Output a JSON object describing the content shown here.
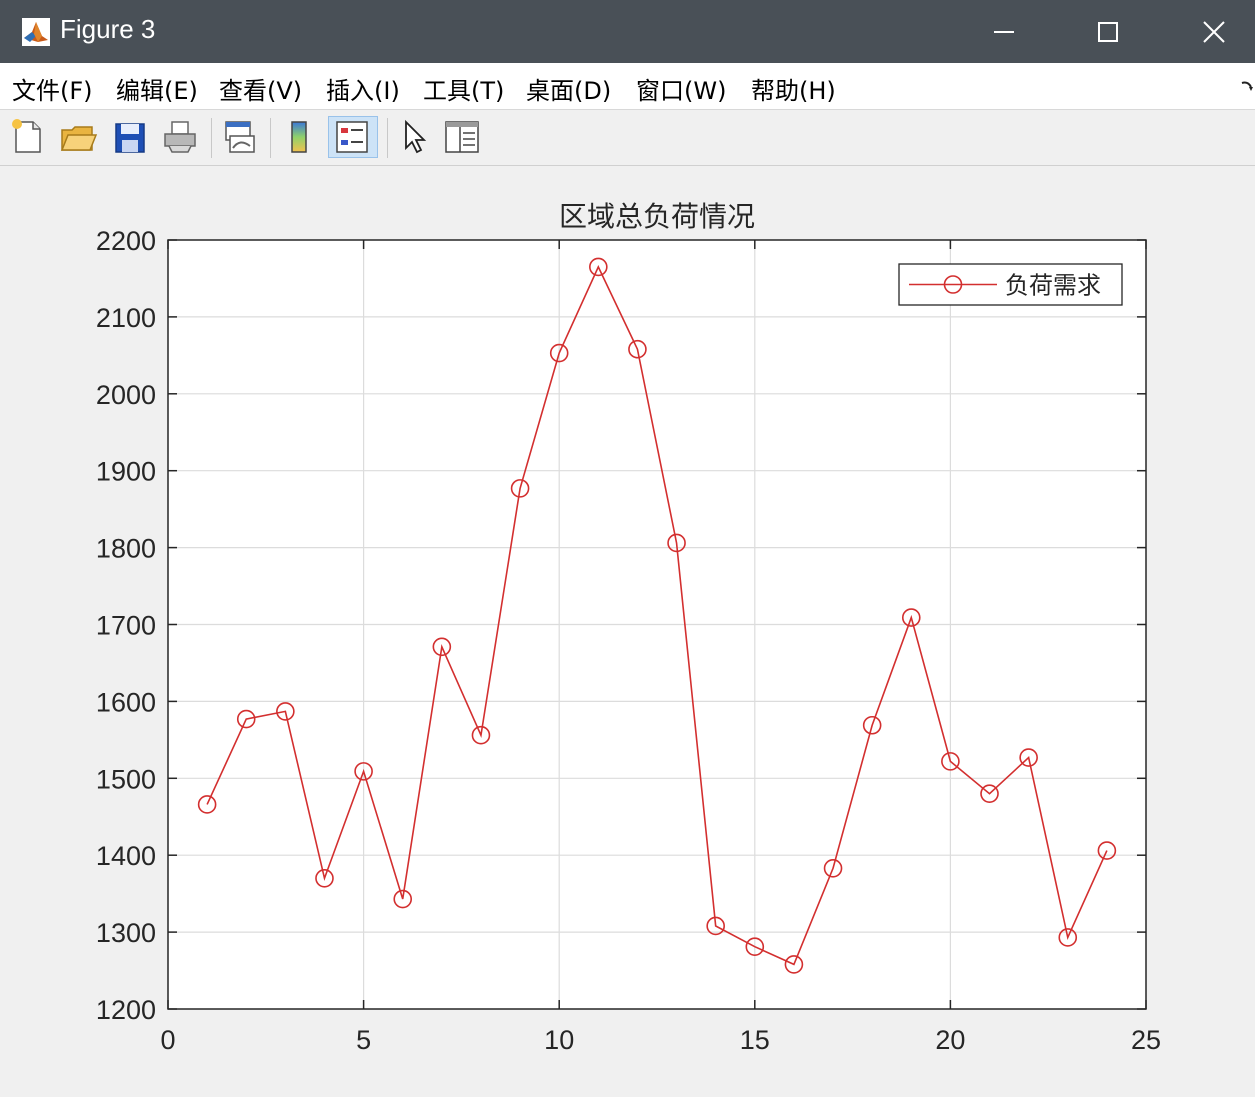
{
  "window": {
    "title": "Figure 3",
    "controls": {
      "minimize": "minimize",
      "maximize": "maximize",
      "close": "close"
    }
  },
  "menu": {
    "items": [
      "文件(F)",
      "编辑(E)",
      "查看(V)",
      "插入(I)",
      "工具(T)",
      "桌面(D)",
      "窗口(W)",
      "帮助(H)"
    ]
  },
  "toolbar": {
    "icons": [
      "new-figure-icon",
      "open-file-icon",
      "save-icon",
      "print-icon",
      "link-plot-icon",
      "colorbar-icon",
      "legend-icon",
      "pointer-icon",
      "property-inspector-icon"
    ]
  },
  "colors": {
    "series": "#d32f2f",
    "titlebar": "#495057",
    "grid": "#dcdcdc",
    "axes": "#262626"
  },
  "chart_data": {
    "type": "line",
    "title": "区域总负荷情况",
    "xlabel": "",
    "ylabel": "",
    "xlim": [
      0,
      25
    ],
    "ylim": [
      1200,
      2200
    ],
    "xticks": [
      0,
      5,
      10,
      15,
      20,
      25
    ],
    "yticks": [
      1200,
      1300,
      1400,
      1500,
      1600,
      1700,
      1800,
      1900,
      2000,
      2100,
      2200
    ],
    "grid": true,
    "legend": "top-right",
    "marker": "circle",
    "series": [
      {
        "name": "负荷需求",
        "x": [
          1,
          2,
          3,
          4,
          5,
          6,
          7,
          8,
          9,
          10,
          11,
          12,
          13,
          14,
          15,
          16,
          17,
          18,
          19,
          20,
          21,
          22,
          23,
          24
        ],
        "y": [
          1466,
          1577,
          1587,
          1370,
          1509,
          1343,
          1671,
          1556,
          1877,
          2053,
          2165,
          2058,
          1806,
          1308,
          1281,
          1258,
          1383,
          1569,
          1709,
          1522,
          1480,
          1527,
          1293,
          1406
        ]
      }
    ]
  }
}
